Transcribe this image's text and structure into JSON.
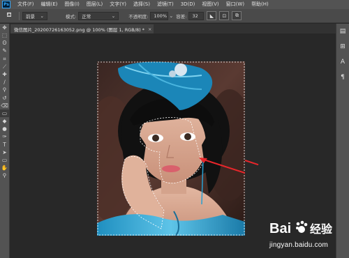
{
  "app": {
    "logo_text": "Ps"
  },
  "menubar": {
    "items": [
      "文件(F)",
      "编辑(E)",
      "图像(I)",
      "图层(L)",
      "文字(Y)",
      "选择(S)",
      "滤镜(T)",
      "3D(D)",
      "视图(V)",
      "窗口(W)",
      "帮助(H)"
    ]
  },
  "options": {
    "tool_icon": "lasso-icon",
    "fg_select": "前景",
    "mode_label": "模式:",
    "mode_value": "正常",
    "opacity_label": "不透明度:",
    "opacity_value": "100%",
    "tolerance_label": "容差:",
    "tolerance_value": "32"
  },
  "document": {
    "tab_title": "微信图片_20200726163052.png @ 100% (图层 1, RGB/8) *",
    "close_glyph": "×"
  },
  "toolbar": {
    "tools": [
      "move-icon",
      "marquee-icon",
      "lasso-icon",
      "quick-select-icon",
      "crop-icon",
      "eyedropper-icon",
      "healing-icon",
      "brush-icon",
      "clone-stamp-icon",
      "history-brush-icon",
      "eraser-icon",
      "gradient-icon",
      "blur-icon",
      "dodge-icon",
      "pen-icon",
      "type-icon",
      "path-select-icon",
      "shape-icon",
      "hand-icon",
      "zoom-icon"
    ],
    "glyphs": [
      "✥",
      "⬚",
      "ʘ",
      "✎",
      "⌗",
      "⟋",
      "✚",
      "∕",
      "⚲",
      "↺",
      "⌫",
      "▭",
      "◆",
      "●",
      "✑",
      "T",
      "➤",
      "▭",
      "✋",
      "⚲"
    ]
  },
  "rightpanel": {
    "icons": [
      "layers-icon",
      "properties-icon",
      "character-icon",
      "paragraph-icon"
    ],
    "glyphs": [
      "▤",
      "⊞",
      "A",
      "¶"
    ]
  },
  "watermark": {
    "brand": "Bai",
    "brand2": "经验",
    "url": "jingyan.baidu.com"
  },
  "colors": {
    "accent": "#31a8ff",
    "menu_bg": "#535353",
    "canvas_bg": "#282828",
    "arrow": "#e8262b"
  }
}
